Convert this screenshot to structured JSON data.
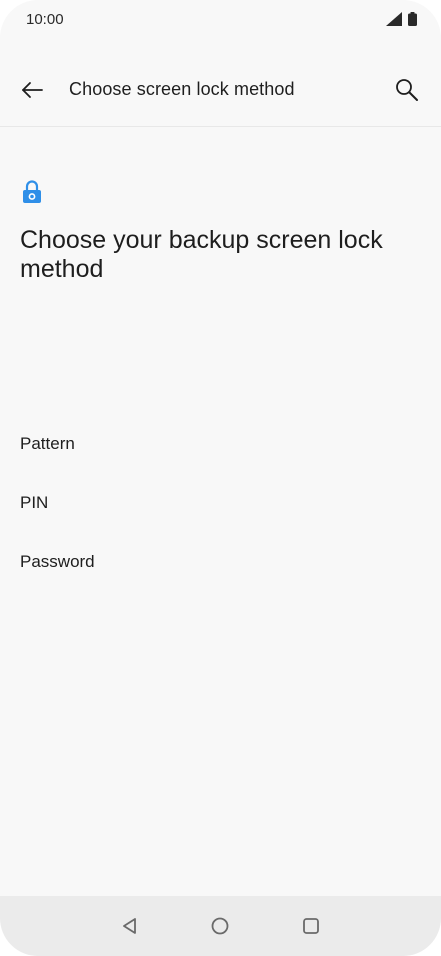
{
  "status_bar": {
    "time": "10:00",
    "icons": [
      "signal-icon",
      "battery-icon"
    ]
  },
  "app_bar": {
    "title": "Choose screen lock method",
    "back_icon": "arrow-left-icon",
    "search_icon": "search-icon"
  },
  "main": {
    "icon": "lock-icon",
    "heading": "Choose your backup screen lock method",
    "accent_color": "#2f8fe8",
    "options": [
      {
        "label": "Pattern"
      },
      {
        "label": "PIN"
      },
      {
        "label": "Password"
      }
    ]
  },
  "nav_bar": {
    "buttons": [
      "back-triangle-icon",
      "home-circle-icon",
      "recents-square-icon"
    ]
  }
}
